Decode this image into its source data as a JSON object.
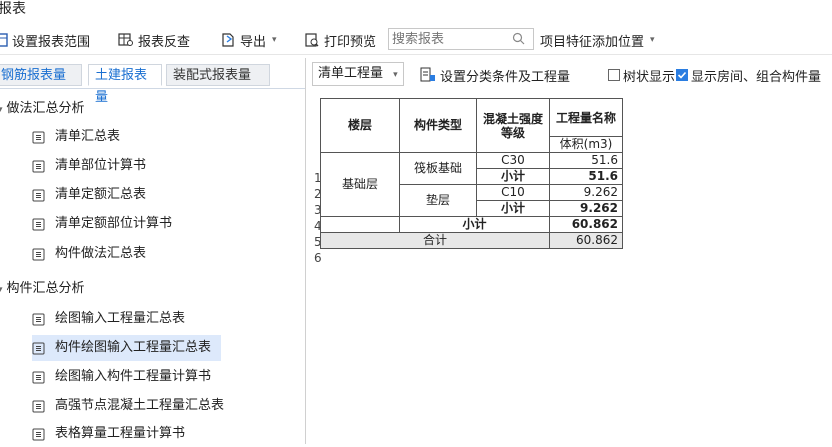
{
  "window": {
    "title": "报表"
  },
  "toolbar": {
    "set_range": "设置报表范围",
    "report_check": "报表反查",
    "export": "导出",
    "print_preview": "打印预览",
    "search_placeholder": "搜索报表",
    "feature_position": "项目特征添加位置"
  },
  "tabs": [
    "钢筋报表量",
    "土建报表量",
    "装配式报表量"
  ],
  "tree": {
    "group1": "做法汇总分析",
    "group1_items": [
      "清单汇总表",
      "清单部位计算书",
      "清单定额汇总表",
      "清单定额部位计算书",
      "构件做法汇总表"
    ],
    "group2": "构件汇总分析",
    "group2_items": [
      "绘图输入工程量汇总表",
      "构件绘图输入工程量汇总表",
      "绘图输入构件工程量计算书",
      "高强节点混凝土工程量汇总表",
      "表格算量工程量计算书"
    ]
  },
  "right_toolbar": {
    "quantity_select": "清单工程量",
    "classify_condition": "设置分类条件及工程量",
    "tree_display": "树状显示",
    "room_display": "显示房间、组合构件量"
  },
  "report": {
    "headers": {
      "floor": "楼层",
      "component_type": "构件类型",
      "concrete_grade": "混凝土强度等级",
      "quantity_name": "工程量名称",
      "volume": "体积(m3)"
    },
    "row_numbers": [
      "1",
      "2",
      "3",
      "4",
      "5",
      "6"
    ],
    "floor_value": "基础层",
    "types": [
      "筏板基础",
      "垫层"
    ],
    "grades": [
      "C30",
      "C10"
    ],
    "subtotal_label": "小计",
    "values": [
      "51.6",
      "51.6",
      "9.262",
      "9.262",
      "60.862",
      "60.862"
    ],
    "total_label": "合计"
  },
  "colors": {
    "accent": "#1a6fd1",
    "selected_row": "#dde9fb",
    "total_row": "#e8e8e8"
  }
}
